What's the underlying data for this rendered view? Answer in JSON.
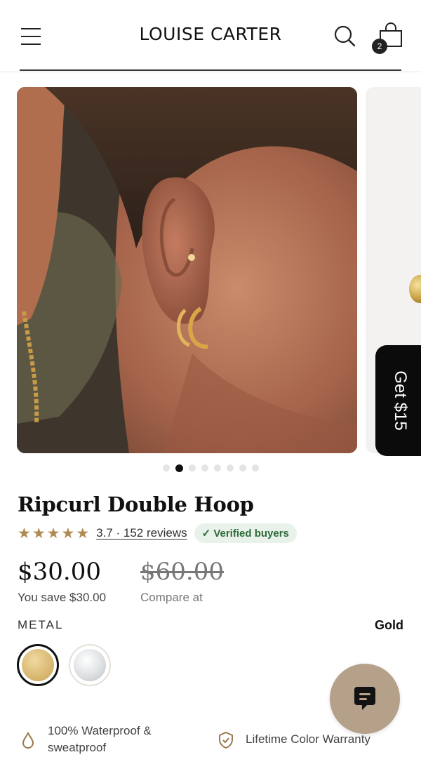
{
  "header": {
    "logo": "LOUISE CARTER",
    "cart_count": "2"
  },
  "gallery": {
    "slide_count": 8,
    "active_index": 1,
    "promo_tab": "Get $15"
  },
  "product": {
    "title": "Ripcurl Double Hoop",
    "rating": 3.7,
    "stars_shown": 5,
    "reviews_text": "3.7 · 152 reviews",
    "verified_badge": "✓ Verified buyers",
    "price": "$30.00",
    "you_save": "You save $30.00",
    "compare_price": "$60.00",
    "compare_label": "Compare at"
  },
  "options": {
    "metal_label": "METAL",
    "metal_selected": "Gold",
    "swatches": [
      "gold-swatch",
      "silver-swatch"
    ]
  },
  "features": [
    {
      "icon": "droplet-icon",
      "text": "100% Waterproof & sweatproof"
    },
    {
      "icon": "shield-check-icon",
      "text": "Lifetime Color Warranty"
    }
  ],
  "colors": {
    "star": "#b08a52",
    "verified_bg": "#e8f2ea",
    "verified_text": "#2f6b3a",
    "chat_bg": "#b5a08a",
    "promo_bg": "#0b0b0b"
  }
}
